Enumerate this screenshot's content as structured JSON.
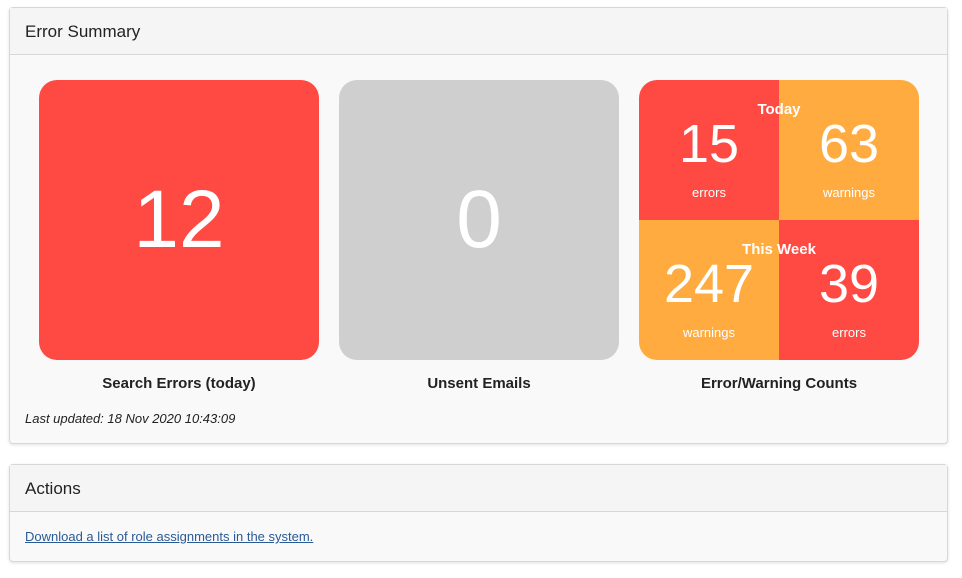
{
  "error_summary": {
    "title": "Error Summary",
    "search_errors": {
      "value": "12",
      "label": "Search Errors (today)",
      "color": "#ff4a44"
    },
    "unsent_emails": {
      "value": "0",
      "label": "Unsent Emails",
      "color": "#cfcfcf"
    },
    "counts": {
      "label": "Error/Warning Counts",
      "today_caption": "Today",
      "week_caption": "This Week",
      "today_errors": "15",
      "today_errors_label": "errors",
      "today_warnings": "63",
      "today_warnings_label": "warnings",
      "week_warnings": "247",
      "week_warnings_label": "warnings",
      "week_errors": "39",
      "week_errors_label": "errors"
    },
    "last_updated": "Last updated: 18 Nov 2020 10:43:09"
  },
  "actions": {
    "title": "Actions",
    "link": "Download a list of role assignments in the system."
  }
}
